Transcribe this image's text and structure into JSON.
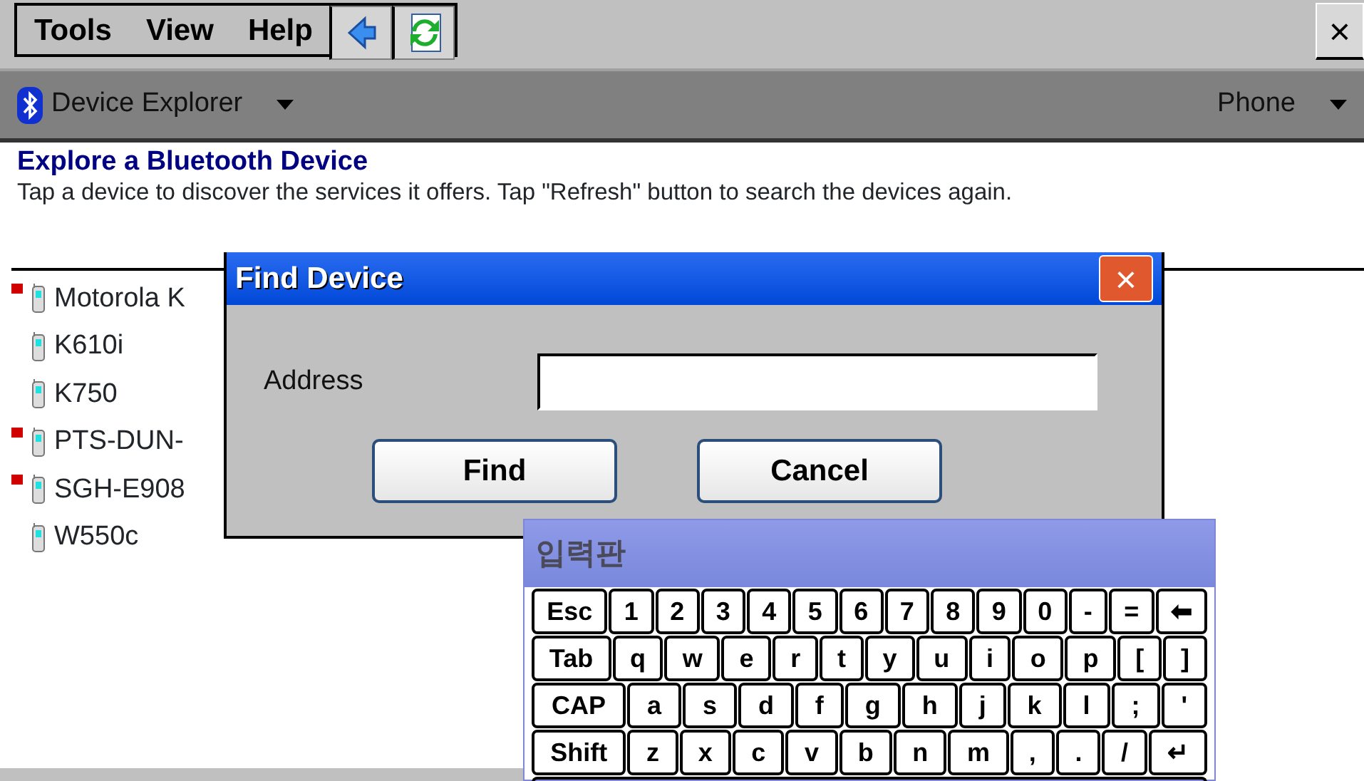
{
  "menu_bar": {
    "items": [
      "Tools",
      "View",
      "Help"
    ],
    "close": "×"
  },
  "nav_bar": {
    "title": "Device Explorer",
    "right": "Phone"
  },
  "heading": "Explore a Bluetooth Device",
  "description": "Tap a device to discover the services it offers. Tap \"Refresh\" button to search the devices again.",
  "devices": [
    {
      "name": "Motorola K",
      "paired": true
    },
    {
      "name": "K610i",
      "paired": false
    },
    {
      "name": "K750",
      "paired": false
    },
    {
      "name": "PTS-DUN-",
      "paired": true
    },
    {
      "name": "SGH-E908",
      "paired": true
    },
    {
      "name": "W550c",
      "paired": false
    }
  ],
  "dialog": {
    "title": "Find Device",
    "close": "×",
    "label": "Address",
    "buttons": [
      "Find",
      "Cancel"
    ]
  },
  "keyboard": {
    "title": "입력판",
    "key_rows": [
      {
        "keys": [
          "Esc",
          "1",
          "2",
          "3",
          "4",
          "5",
          "6",
          "7",
          "8",
          "9",
          "0",
          "-",
          "=",
          "⬅"
        ]
      },
      {
        "keys": [
          "Tab",
          "q",
          "w",
          "e",
          "r",
          "t",
          "y",
          "u",
          "i",
          "o",
          "p",
          "[",
          "]"
        ]
      },
      {
        "keys": [
          "CAP",
          "a",
          "s",
          "d",
          "f",
          "g",
          "h",
          "j",
          "k",
          "l",
          ";",
          "'"
        ]
      },
      {
        "keys": [
          "Shift",
          "z",
          "x",
          "c",
          "v",
          "b",
          "n",
          "m",
          ",",
          ".",
          "/",
          "↵"
        ]
      }
    ]
  }
}
